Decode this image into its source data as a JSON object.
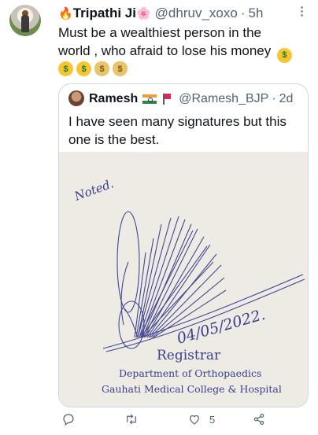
{
  "tweet": {
    "author_name": "Tripathi Ji",
    "name_prefix_emoji": "🔥",
    "name_suffix_emoji": "🌸",
    "handle": "@dhruv_xoxo",
    "separator": "·",
    "time": "5h",
    "text_line1": "Must be a wealthiest person in the",
    "text_line2": "world , who afraid to lose his money",
    "inline_emoji": "🤑",
    "emoji_row": [
      "🤑",
      "🤑",
      "💰",
      "💰"
    ],
    "emoji_row_glyphs": [
      "$",
      "$",
      "$",
      "$"
    ]
  },
  "quoted_tweet": {
    "author_name": "Ramesh",
    "handle": "@Ramesh_BJP",
    "separator": "·",
    "time": "2d",
    "text_line1": "I have seen many signatures but this",
    "text_line2": "one is the best.",
    "image": {
      "handwritten_note": "Noted.",
      "date": "04/05/2022.",
      "title": "Registrar",
      "department": "Department of Orthopaedics",
      "college": "Gauhati Medical College & Hospital"
    }
  },
  "actions": {
    "reply_icon": "reply-icon",
    "retweet_icon": "retweet-icon",
    "like_icon": "heart-icon",
    "like_count": "5",
    "share_icon": "share-icon"
  },
  "colors": {
    "text": "#0f1419",
    "muted": "#536471",
    "border": "#cfd9de",
    "ink": "#3b3f8e"
  }
}
